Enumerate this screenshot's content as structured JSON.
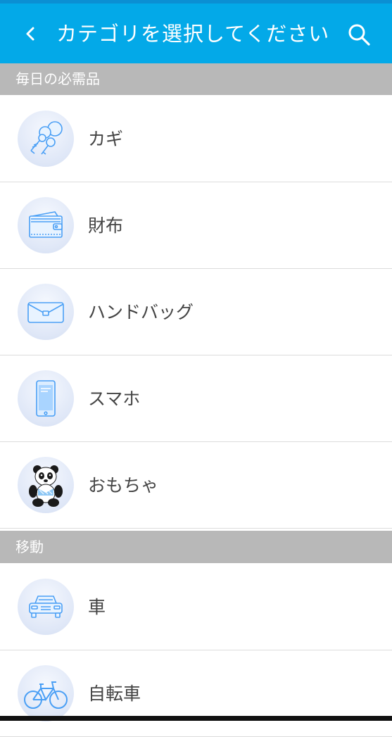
{
  "colors": {
    "appbar": "#03a9e8",
    "section": "#b8b8b8",
    "icon_stroke": "#4a9ff5"
  },
  "header": {
    "back_icon": "chevron-left-icon",
    "title": "カテゴリを選択してください",
    "search_icon": "search-icon"
  },
  "sections": [
    {
      "title": "毎日の必需品",
      "items": [
        {
          "label": "カギ",
          "icon": "keys-icon"
        },
        {
          "label": "財布",
          "icon": "wallet-icon"
        },
        {
          "label": "ハンドバッグ",
          "icon": "handbag-icon"
        },
        {
          "label": "スマホ",
          "icon": "smartphone-icon"
        },
        {
          "label": "おもちゃ",
          "icon": "panda-toy-icon"
        }
      ]
    },
    {
      "title": "移動",
      "items": [
        {
          "label": "車",
          "icon": "car-icon"
        },
        {
          "label": "自転車",
          "icon": "bicycle-icon"
        }
      ]
    }
  ]
}
